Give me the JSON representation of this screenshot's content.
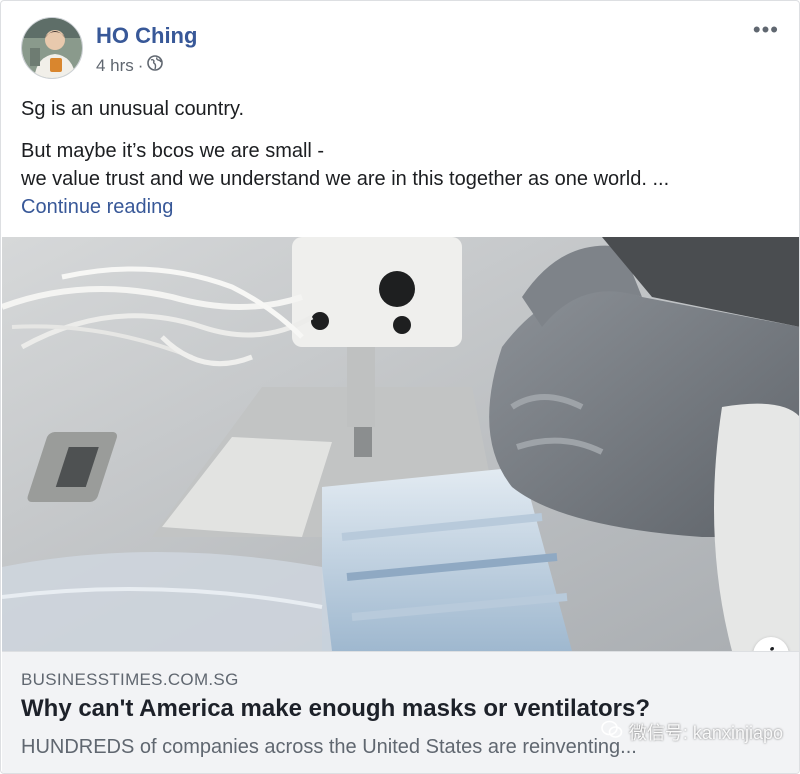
{
  "post": {
    "author": "HO Ching",
    "time": "4 hrs",
    "separator": "·",
    "more_label": "•••",
    "text": {
      "line1": "Sg is an unusual country.",
      "line2": "But maybe it’s bcos we are small -",
      "line3": "we value trust and we understand we are in this together as one world. ...",
      "continue": "Continue reading"
    }
  },
  "link": {
    "domain": "BUSINESSTIMES.COM.SG",
    "headline": "Why can't America make enough masks or ventilators?",
    "description": "HUNDREDS of companies across the United States are reinventing..."
  },
  "info_label": "i",
  "watermark": {
    "text": "微信号: kanxinjiapo"
  },
  "colors": {
    "author_link": "#385898",
    "meta_gray": "#606770",
    "footer_bg": "#f2f3f5"
  }
}
